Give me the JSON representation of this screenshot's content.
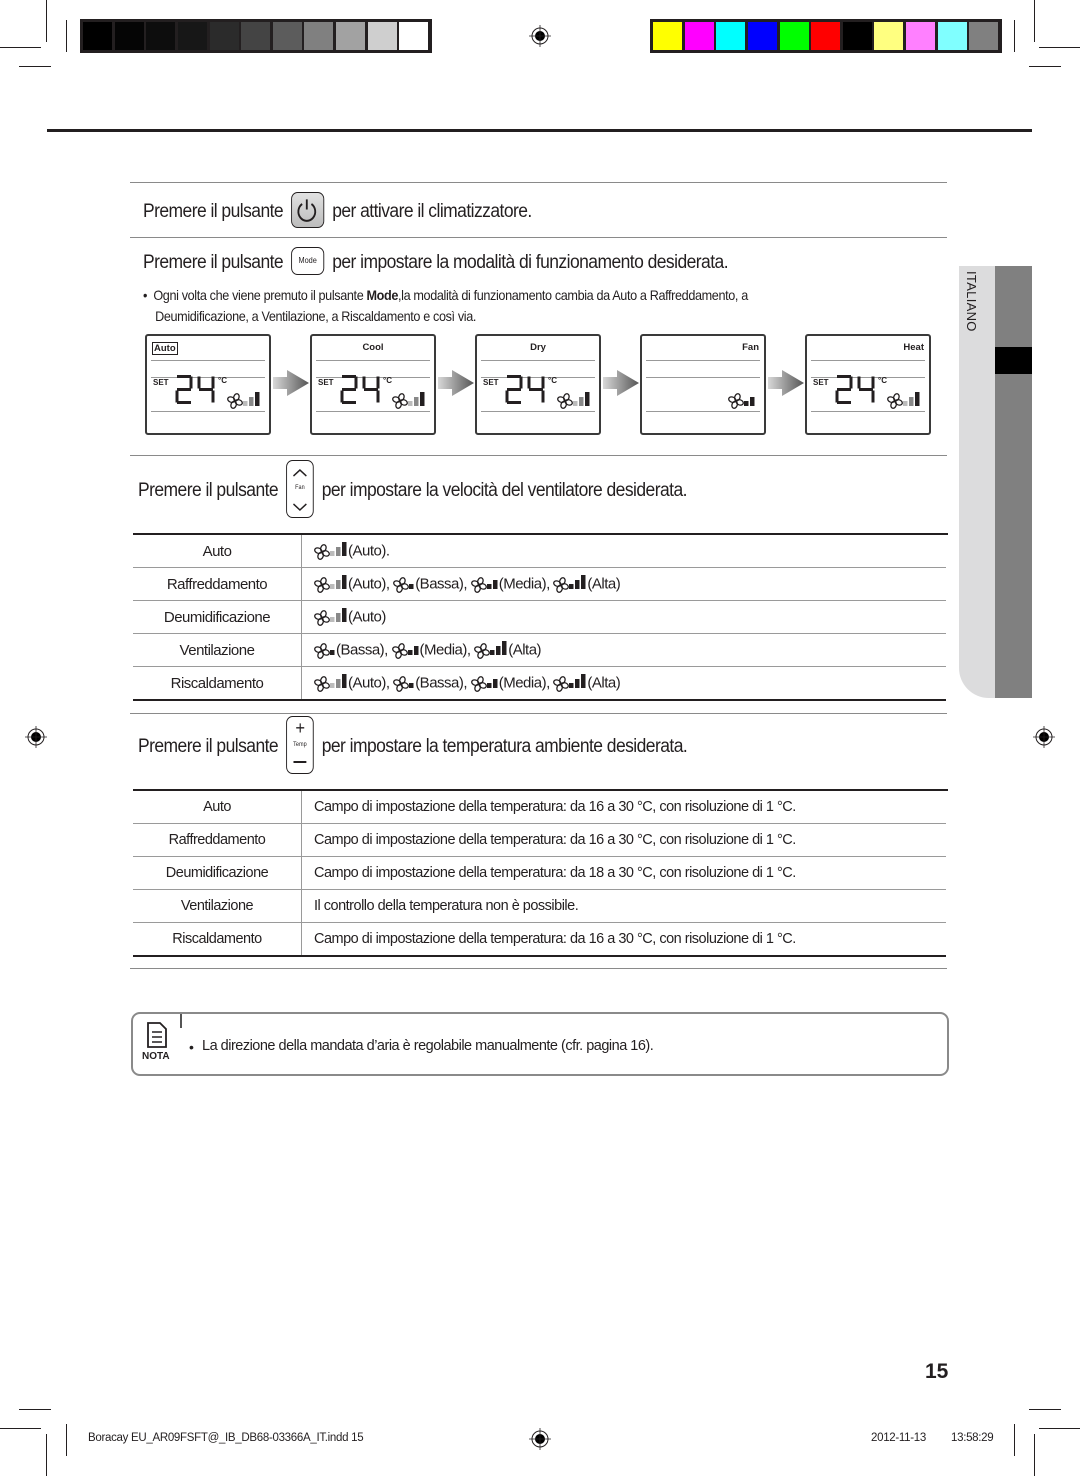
{
  "print_marks": {
    "grayscale_swatches": [
      "#000000",
      "#050505",
      "#0d0d0d",
      "#171717",
      "#2b2b2b",
      "#444444",
      "#5c5c5c",
      "#808080",
      "#a2a2a2",
      "#cfcfcf",
      "#ffffff"
    ],
    "color_swatches": [
      "#ffff00",
      "#ff00ff",
      "#00ffff",
      "#0000ff",
      "#00ff00",
      "#ff0000",
      "#000000",
      "#ffff80",
      "#ff80ff",
      "#80ffff",
      "#808080"
    ]
  },
  "sections": {
    "power": {
      "prefix": "Premere il pulsante",
      "suffix": "per attivare il climatizzatore.",
      "button_icon": "power-icon"
    },
    "mode": {
      "prefix": "Premere il pulsante",
      "button_label": "Mode",
      "suffix": "per impostare la modalità di funzionamento desiderata.",
      "bullet": "•",
      "desc_line1_a": "Ogni volta che viene premuto il pulsante ",
      "desc_line1_bold": "Mode",
      "desc_line1_b": ",la modalità di funzionamento cambia da Auto a Raffreddamento, a",
      "desc_line2": "Deumidificazione, a Ventilazione, a Riscaldamento e così via.",
      "displays": [
        {
          "mode": "Auto",
          "boxed": true,
          "set": "SET",
          "temp": "24",
          "unit": "°C",
          "show_temp": true,
          "fan": "auto"
        },
        {
          "mode": "Cool",
          "boxed": false,
          "set": "SET",
          "temp": "24",
          "unit": "°C",
          "show_temp": true,
          "fan": "auto"
        },
        {
          "mode": "Dry",
          "boxed": false,
          "set": "SET",
          "temp": "24",
          "unit": "°C",
          "show_temp": true,
          "fan": "auto"
        },
        {
          "mode": "Fan",
          "boxed": false,
          "set": "",
          "temp": "",
          "unit": "",
          "show_temp": false,
          "fan": "medium"
        },
        {
          "mode": "Heat",
          "boxed": false,
          "set": "SET",
          "temp": "24",
          "unit": "°C",
          "show_temp": true,
          "fan": "auto"
        }
      ]
    },
    "fan": {
      "prefix": "Premere il pulsante",
      "button_label": "Fan",
      "suffix": "per impostare la velocità del ventilatore  desiderata.",
      "rows": [
        {
          "mode": "Auto",
          "options": [
            {
              "level": "auto",
              "label": "(Auto)."
            }
          ]
        },
        {
          "mode": "Raffreddamento",
          "options": [
            {
              "level": "auto",
              "label": "(Auto),"
            },
            {
              "level": "low",
              "label": "(Bassa),"
            },
            {
              "level": "medium",
              "label": "(Media),"
            },
            {
              "level": "high",
              "label": "(Alta)"
            }
          ]
        },
        {
          "mode": "Deumidificazione",
          "options": [
            {
              "level": "auto",
              "label": "(Auto)"
            }
          ]
        },
        {
          "mode": "Ventilazione",
          "options": [
            {
              "level": "low",
              "label": "(Bassa),"
            },
            {
              "level": "medium",
              "label": "(Media),"
            },
            {
              "level": "high",
              "label": "(Alta)"
            }
          ]
        },
        {
          "mode": "Riscaldamento",
          "options": [
            {
              "level": "auto",
              "label": "(Auto),"
            },
            {
              "level": "low",
              "label": "(Bassa),"
            },
            {
              "level": "medium",
              "label": "(Media),"
            },
            {
              "level": "high",
              "label": "(Alta)"
            }
          ]
        }
      ]
    },
    "temp": {
      "prefix": "Premere il pulsante",
      "button_label": "Temp",
      "suffix": "per impostare la temperatura ambiente  desiderata.",
      "rows": [
        {
          "mode": "Auto",
          "desc": "Campo di impostazione della temperatura: da 16 a 30 °C, con risoluzione  di 1 °C."
        },
        {
          "mode": "Raffreddamento",
          "desc": "Campo di impostazione della temperatura: da 16 a 30 °C, con risoluzione  di 1 °C."
        },
        {
          "mode": "Deumidificazione",
          "desc": "Campo di impostazione della temperatura: da 18 a 30 °C, con risoluzione  di 1 °C."
        },
        {
          "mode": "Ventilazione",
          "desc": "Il controllo della temperatura non è possibile."
        },
        {
          "mode": "Riscaldamento",
          "desc": "Campo di impostazione della temperatura: da 16 a 30 °C, con risoluzione  di 1 °C."
        }
      ]
    }
  },
  "note": {
    "label": "NOTA",
    "bullet": "•",
    "text": "La direzione della  mandata d’aria è regolabile manualmente (cfr. pagina 16)."
  },
  "side_tab": {
    "label": "ITALIANO"
  },
  "page_number": "15",
  "footer": {
    "file": "Boracay EU_AR09FSFT@_IB_DB68-03366A_IT.indd   15",
    "date": "2012-11-13",
    "time": "13:58:29"
  }
}
